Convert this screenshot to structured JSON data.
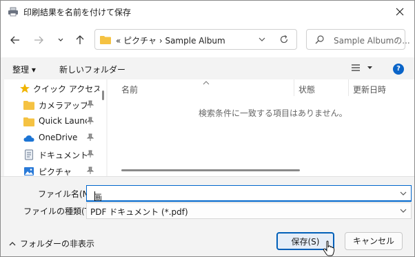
{
  "window": {
    "title": "印刷結果を名前を付けて保存"
  },
  "address": {
    "text": "«  ピクチャ  ›  Sample Album"
  },
  "search": {
    "placeholder": "Sample Albumの..."
  },
  "commands": {
    "organize": "整理 ▾",
    "new_folder": "新しいフォルダー",
    "help": "?"
  },
  "sidebar": {
    "items": [
      {
        "label": "クイック アクセス",
        "icon": "star-icon"
      },
      {
        "label": "カメラアップロー",
        "icon": "folder-icon"
      },
      {
        "label": "Quick Launcl",
        "icon": "folder-icon"
      },
      {
        "label": "OneDrive",
        "icon": "cloud-icon"
      },
      {
        "label": "ドキュメント",
        "icon": "document-icon"
      },
      {
        "label": "ピクチャ",
        "icon": "pictures-icon"
      }
    ]
  },
  "filelist": {
    "columns": [
      "名前",
      "状態",
      "更新日時"
    ],
    "empty_message": "検索条件に一致する項目はありません。"
  },
  "form": {
    "filename_label": "ファイル名(N):",
    "filename_value": "画像",
    "filetype_label": "ファイルの種類(T):",
    "filetype_value": "PDF ドキュメント (*.pdf)"
  },
  "footer": {
    "hide_folders": "フォルダーの非表示",
    "save": "保存(S)",
    "cancel": "キャンセル"
  },
  "colors": {
    "accent": "#005fb8",
    "folder": "#f5c242",
    "star": "#f0b400"
  }
}
